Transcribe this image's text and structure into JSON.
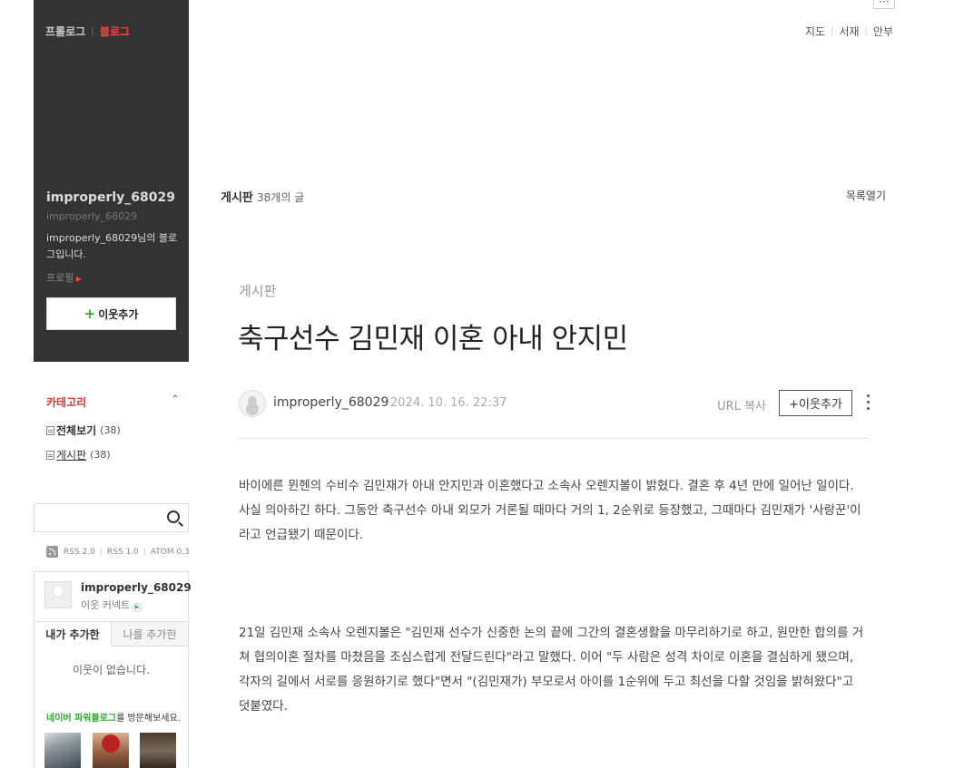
{
  "top_nav": {
    "links": [
      "지도",
      "서재",
      "안부"
    ]
  },
  "sidebar": {
    "tabs": {
      "prologue": "프롤로그",
      "blog": "블로그"
    },
    "nickname": "improperly_68029",
    "blog_id": "improperly_68029",
    "intro": "improperly_68029님의 블로그입니다.",
    "profile_link": "프로필",
    "add_neighbor": "이웃추가",
    "category_title": "카테고리",
    "categories": [
      {
        "label": "전체보기",
        "count": "(38)"
      },
      {
        "label": "게시판",
        "count": "(38)"
      }
    ],
    "search": {
      "placeholder": ""
    },
    "rss": [
      "RSS 2.0",
      "RSS 1.0",
      "ATOM 0.3"
    ],
    "neighbor_widget": {
      "name": "improperly_68029",
      "comment": "이웃 커넥트",
      "tab_mine": "내가 추가한",
      "tab_others": "나를 추가한",
      "empty": "이웃이 없습니다.",
      "power_highlight": "네이버 파워블로그",
      "power_rest": "를 방문해보세요."
    }
  },
  "main": {
    "board_title": "게시판",
    "board_count": "38개의 글",
    "list_open": "목록열기",
    "post": {
      "category": "게시판",
      "title": "축구선수 김민재 이혼 아내 안지민",
      "author": "improperly_68029",
      "date": "2024. 10. 16. 22:37",
      "url_copy": "URL 복사",
      "add_neighbor": "+이웃추가",
      "paragraphs": [
        "바이에른 뮌헨의 수비수 김민재가 아내 안지민과 이혼했다고 소속사 오렌지볼이 밝혔다. 결혼 후 4년 만에 일어난 일이다. 사실 의아하긴 하다. 그동안 축구선수 아내 외모가 거론될 때마다 거의 1, 2순위로 등장했고, 그때마다 김민재가 '사랑꾼'이라고 언급됐기 때문이다.",
        "21일 김민재 소속사 오렌지볼은 \"김민재 선수가 신중한 논의 끝에 그간의 결혼생활을 마무리하기로 하고, 원만한 합의를 거쳐 협의이혼 절차를 마쳤음을 조심스럽게 전달드린다\"라고 말했다. 이어 \"두 사람은 성격 차이로 이혼을 결심하게 됐으며, 각자의 길에서 서로를 응원하기로 했다\"면서 \"(김민재가) 부모로서 아이를 1순위에 두고 최선을 다할 것임을 밝혀왔다\"고 덧붙였다."
      ]
    }
  }
}
